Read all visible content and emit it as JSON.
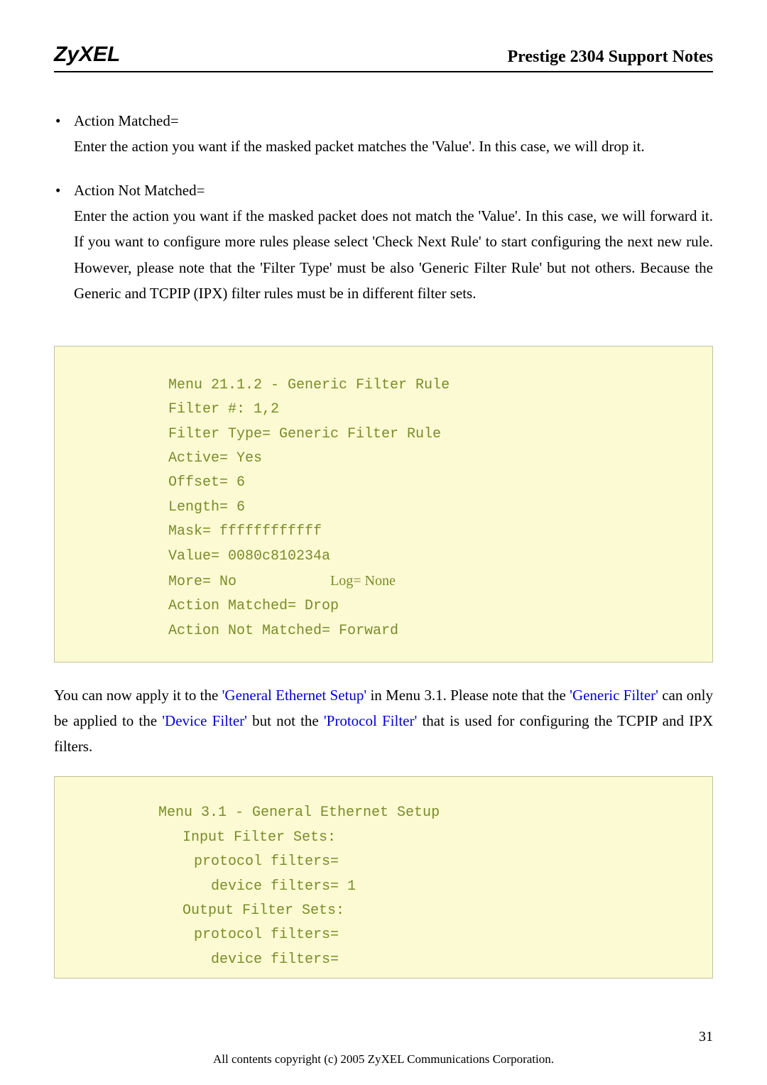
{
  "header": {
    "logo": "ZyXEL",
    "title": "Prestige 2304 Support Notes"
  },
  "bullets": [
    {
      "title": "Action Matched=",
      "body": "Enter the action you want if the masked packet matches the 'Value'. In this case, we will drop it."
    },
    {
      "title": "Action Not Matched=",
      "body": "Enter the action you want if the masked packet does not match the 'Value'. In this case, we will forward it. If you want to configure more rules please select 'Check Next Rule' to start configuring the next new rule. However, please note that the 'Filter Type' must be also 'Generic Filter Rule' but not others. Because the Generic and TCPIP (IPX) filter rules must be in different filter sets."
    }
  ],
  "code1": {
    "l0": "Menu 21.1.2 - Generic Filter Rule",
    "l1": "Filter #: 1,2",
    "l2": "Filter Type= Generic Filter Rule",
    "l3": "Active= Yes",
    "l4": "Offset= 6",
    "l5": "Length= 6",
    "l6": "Mask= ffffffffffff",
    "l7": "Value= 0080c810234a",
    "l8a": "More= No           ",
    "l8b": "Log= None",
    "l9": "Action Matched= Drop",
    "l10": "Action Not Matched= Forward"
  },
  "paragraph": {
    "p1": "You can now apply it to the ",
    "link1": "'General Ethernet Setup'",
    "p2": " in Menu 3.1. Please note that the ",
    "link2": "'Generic Filter'",
    "p3": " can only be applied to the ",
    "link3": "'Device Filter'",
    "p4": " but not the ",
    "link4": "'Protocol Filter'",
    "p5": " that is used for configuring the TCPIP and IPX filters."
  },
  "code2": {
    "l0": "Menu 3.1 - General Ethernet Setup",
    "l1": "Input Filter Sets:",
    "l2": "protocol filters=",
    "l3": "device filters= 1",
    "l4": "Output Filter Sets:",
    "l5": "protocol filters=",
    "l6": "device filters="
  },
  "footer": {
    "pageNumber": "31",
    "copyright": "All contents copyright (c) 2005 ZyXEL Communications Corporation."
  }
}
